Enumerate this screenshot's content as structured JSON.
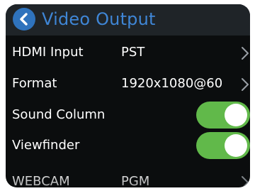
{
  "header": {
    "title": "Video Output",
    "back_icon": "chevron-left-icon"
  },
  "rows": [
    {
      "label": "HDMI Input",
      "value": "PST",
      "control": "chevron"
    },
    {
      "label": "Format",
      "value": "1920x1080@60",
      "control": "chevron"
    },
    {
      "label": "Sound Column",
      "control": "toggle",
      "on": true
    },
    {
      "label": "Viewfinder",
      "control": "toggle",
      "on": true
    },
    {
      "label": "WEBCAM",
      "value": "PGM",
      "control": "chevron"
    }
  ],
  "colors": {
    "background": "#0b0d0e",
    "header": "#1f2428",
    "accent": "#3f86d6",
    "toggle_on": "#61b94a"
  }
}
